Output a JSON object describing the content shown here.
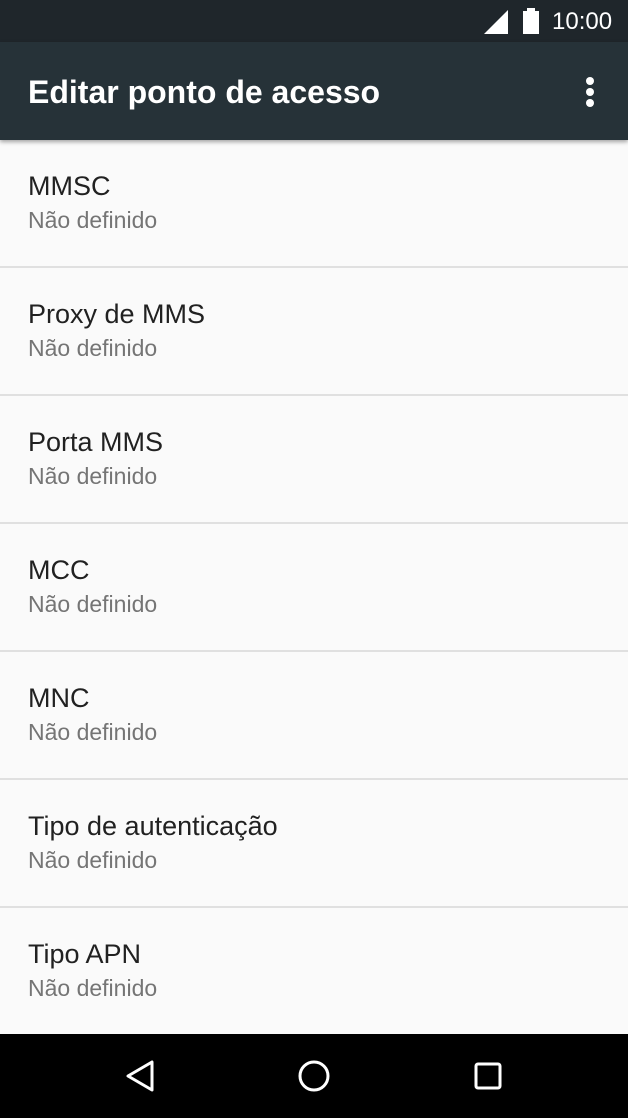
{
  "status_bar": {
    "time": "10:00",
    "icons": [
      "cell-signal-icon",
      "battery-icon"
    ]
  },
  "app_bar": {
    "title": "Editar ponto de acesso",
    "overflow_icon": "more-vert-icon"
  },
  "items": [
    {
      "title": "MMSC",
      "summary": "Não definido"
    },
    {
      "title": "Proxy de MMS",
      "summary": "Não definido"
    },
    {
      "title": "Porta MMS",
      "summary": "Não definido"
    },
    {
      "title": "MCC",
      "summary": "Não definido"
    },
    {
      "title": "MNC",
      "summary": "Não definido"
    },
    {
      "title": "Tipo de autenticação",
      "summary": "Não definido"
    },
    {
      "title": "Tipo APN",
      "summary": "Não definido"
    }
  ],
  "nav_bar": {
    "icons": [
      "back-icon",
      "home-icon",
      "recents-icon"
    ]
  },
  "colors": {
    "status_bar": "#1f262b",
    "app_bar": "#263238",
    "background": "#fafafa",
    "divider": "#e0e0e0",
    "title_text": "#212121",
    "summary_text": "#757575",
    "nav_bar": "#000000"
  }
}
